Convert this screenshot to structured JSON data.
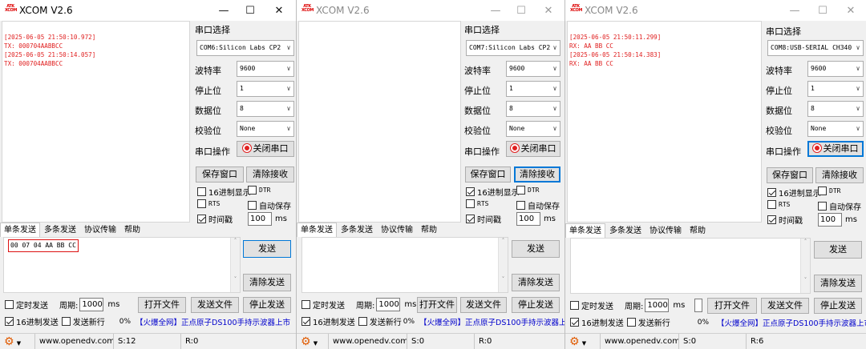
{
  "app": {
    "title": "XCOM V2.6",
    "logo_text": "ATK XCOM"
  },
  "labels": {
    "port_select": "串口选择",
    "baud": "波特率",
    "stop_bits": "停止位",
    "data_bits": "数据位",
    "parity": "校验位",
    "port_op": "串口操作",
    "close_port": "关闭串口",
    "save_window": "保存窗口",
    "clear_recv": "清除接收",
    "hex_display": "16进制显示",
    "dtr": "DTR",
    "rts": "RTS",
    "auto_save": "自动保存",
    "timestamp": "时间戳",
    "ms": "ms",
    "tabs": [
      "单条发送",
      "多条发送",
      "协议传输",
      "帮助"
    ],
    "send": "发送",
    "clear_send": "清除发送",
    "timed_send": "定时发送",
    "period": "周期:",
    "open_file": "打开文件",
    "send_file": "发送文件",
    "stop_send": "停止发送",
    "hex_send": "16进制发送",
    "send_newline": "发送新行",
    "ad": "【火爆全网】正点原子DS100手持示波器上市",
    "website": "www.openedv.com"
  },
  "windows": [
    {
      "recv_text": "[2025-06-05 21:50:10.972]\nTX: 000704AABBCC\n[2025-06-05 21:50:14.057]\nTX: 000704AABBCC",
      "port": "COM6:Silicon Labs CP2",
      "baud": "9600",
      "stop": "1",
      "data": "8",
      "parity": "None",
      "timestamp_value": "100",
      "send_text": "00 07 04 AA BB CC",
      "period_value": "1000",
      "percent": "0%",
      "status_s": "S:12",
      "status_r": "R:0"
    },
    {
      "recv_text": "",
      "port": "COM7:Silicon Labs CP2",
      "baud": "9600",
      "stop": "1",
      "data": "8",
      "parity": "None",
      "timestamp_value": "100",
      "send_text": "",
      "period_value": "1000",
      "percent": "0%",
      "status_s": "S:0",
      "status_r": "R:0"
    },
    {
      "recv_text": "[2025-06-05 21:50:11.299]\nRX: AA BB CC\n[2025-06-05 21:50:14.383]\nRX: AA BB CC",
      "port": "COM8:USB-SERIAL CH340",
      "baud": "9600",
      "stop": "1",
      "data": "8",
      "parity": "None",
      "timestamp_value": "100",
      "send_text": "",
      "period_value": "1000",
      "percent": "0%",
      "status_s": "S:0",
      "status_r": "R:6"
    }
  ]
}
